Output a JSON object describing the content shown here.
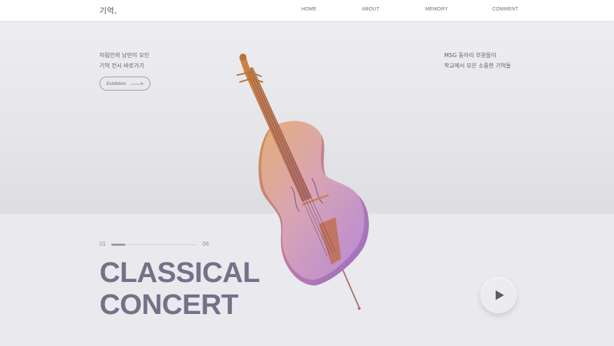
{
  "header": {
    "logo": "기억,",
    "nav": [
      {
        "label": "HOME"
      },
      {
        "label": "ABOUT"
      },
      {
        "label": "MEMORY"
      },
      {
        "label": "COMMENT"
      }
    ]
  },
  "intro_left": {
    "line1": "미림인의 낭만이 모인",
    "line2": "기억 전시 바로가기",
    "button_label": "Exhibition"
  },
  "intro_right": {
    "line1": "MSG 동아리 부원들이",
    "line2": "학교에서 모은 소중한 기억들"
  },
  "slider": {
    "current": "01",
    "total": "06",
    "progress_fraction": 0.16
  },
  "hero": {
    "title_line1": "CLASSICAL",
    "title_line2": "CONCERT"
  },
  "icons": {
    "play": "play-icon",
    "arrow": "arrow-right-icon",
    "cello": "cello-illustration"
  },
  "colors": {
    "title": "#727288",
    "background": "#e9e9ee"
  }
}
